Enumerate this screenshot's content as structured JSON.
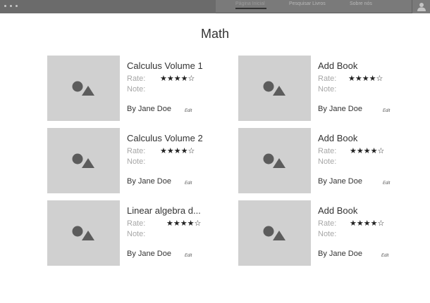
{
  "nav": {
    "active": "Página Inicial",
    "search": "Pesquisar Livros",
    "about": "Sobre nós"
  },
  "page": {
    "title": "Math"
  },
  "books": [
    {
      "title": "Calculus Volume 1",
      "rate_label": "Rate:",
      "note_label": "Note:",
      "stars": "★★★★☆",
      "rating": 4,
      "author": "By Jane Doe",
      "edit": "Edit"
    },
    {
      "title": "Add Book",
      "rate_label": "Rate:",
      "note_label": "Note:",
      "stars": "★★★★☆",
      "rating": 4,
      "author": "By Jane Doe",
      "edit": "Edit"
    },
    {
      "title": "Calculus Volume 2",
      "rate_label": "Rate:",
      "note_label": "Note:",
      "stars": "★★★★☆",
      "rating": 4,
      "author": "By Jane Doe",
      "edit": "Edit"
    },
    {
      "title": "Add Book",
      "rate_label": "Rate:",
      "note_label": "Note:",
      "stars": "★★★★☆",
      "rating": 4,
      "author": "By Jane Doe",
      "edit": "Edit"
    },
    {
      "title": "Linear algebra d...",
      "rate_label": "Rate:",
      "note_label": "Note:",
      "stars": "★★★★☆",
      "rating": 4,
      "author": "By Jane Doe",
      "edit": "Edit"
    },
    {
      "title": "Add Book",
      "rate_label": "Rate:",
      "note_label": "Note:",
      "stars": "★★★★☆",
      "rating": 4,
      "author": "By Jane Doe",
      "edit": "Edit"
    }
  ],
  "icons": {
    "thumbnail": "image-placeholder-icon",
    "account": "user-avatar-icon"
  }
}
